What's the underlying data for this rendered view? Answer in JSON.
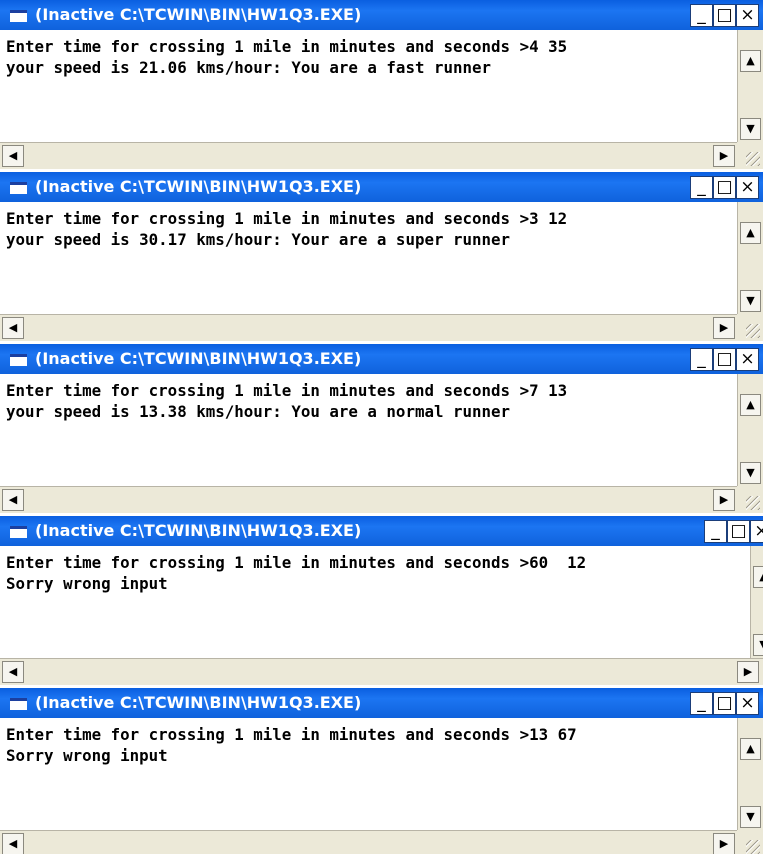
{
  "windows": [
    {
      "title": "(Inactive C:\\TCWIN\\BIN\\HW1Q3.EXE)",
      "lines": [
        "Enter time for crossing 1 mile in minutes and seconds >4 35",
        "your speed is 21.06 kms/hour: You are a fast runner"
      ]
    },
    {
      "title": "(Inactive C:\\TCWIN\\BIN\\HW1Q3.EXE)",
      "lines": [
        "Enter time for crossing 1 mile in minutes and seconds >3 12",
        "your speed is 30.17 kms/hour: Your are a super runner"
      ]
    },
    {
      "title": "(Inactive C:\\TCWIN\\BIN\\HW1Q3.EXE)",
      "lines": [
        "Enter time for crossing 1 mile in minutes and seconds >7 13",
        "your speed is 13.38 kms/hour: You are a normal runner"
      ]
    },
    {
      "title": "(Inactive C:\\TCWIN\\BIN\\HW1Q3.EXE)",
      "lines": [
        "Enter time for crossing 1 mile in minutes and seconds >60  12",
        "Sorry wrong input"
      ]
    },
    {
      "title": "(Inactive C:\\TCWIN\\BIN\\HW1Q3.EXE)",
      "lines": [
        "Enter time for crossing 1 mile in minutes and seconds >13 67",
        "Sorry wrong input"
      ]
    }
  ],
  "controls": {
    "minimize": "_",
    "maximize": "□",
    "close": "×",
    "scroll_up": "▲",
    "scroll_down": "▼",
    "scroll_left": "◀",
    "scroll_right": "▶"
  },
  "icons": {
    "window": "console-window-icon",
    "size_grip": "resize-grip-icon"
  },
  "colors": {
    "titlebar": "#0a5fe0",
    "scrollbar": "#ece9d8",
    "console_text": "#000000",
    "console_background": "#ffffff"
  }
}
